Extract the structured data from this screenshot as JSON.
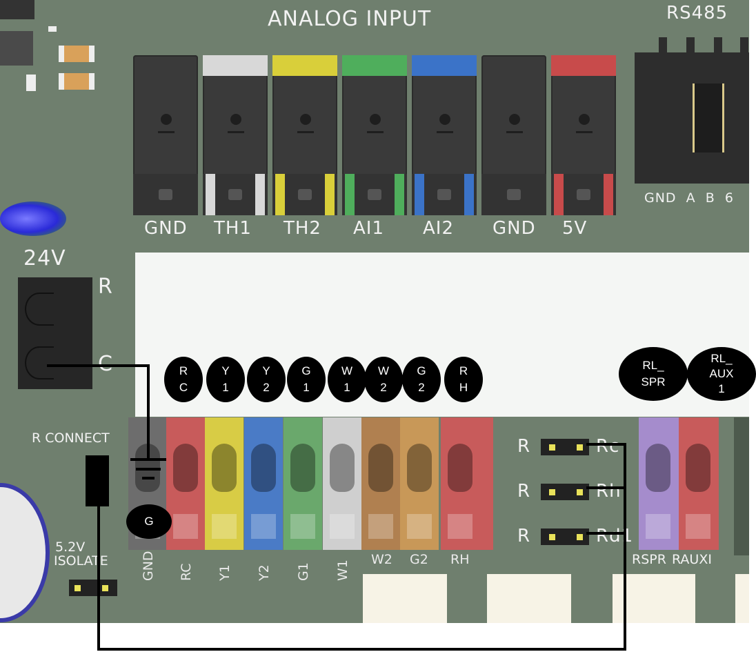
{
  "board": {
    "analog_header": "ANALOG INPUT",
    "rs485_header": "RS485",
    "analog_terminals": [
      {
        "label": "GND",
        "color": ""
      },
      {
        "label": "TH1",
        "color": "#d8d8d8"
      },
      {
        "label": "TH2",
        "color": "#d9cf3a"
      },
      {
        "label": "AI1",
        "color": "#4fae5c"
      },
      {
        "label": "AI2",
        "color": "#3b73c8"
      },
      {
        "label": "GND",
        "color": ""
      },
      {
        "label": "5V",
        "color": "#c84b4b"
      }
    ],
    "rs485_pins": "GND  A  B  6",
    "power_label": "24V",
    "power_r": "R",
    "power_c": "C",
    "r_connect": "R CONNECT",
    "isolate_line1": "5.2V",
    "isolate_line2": "ISOLATE",
    "bottom_terminals": [
      {
        "label": "GND",
        "color": "#6d6d6d"
      },
      {
        "label": "RC",
        "color": "#c85b5b"
      },
      {
        "label": "Y1",
        "color": "#d8cc45"
      },
      {
        "label": "Y2",
        "color": "#4a7bc6"
      },
      {
        "label": "G1",
        "color": "#6aa86c"
      },
      {
        "label": "W1",
        "color": "#cfcfcf"
      },
      {
        "label": "W2",
        "color": "#b08050"
      },
      {
        "label": "G2",
        "color": "#c89858"
      },
      {
        "label": "RH",
        "color": "#c85b5b"
      }
    ],
    "jumpers": [
      {
        "left": "R",
        "right": "Rc"
      },
      {
        "left": "R",
        "right": "Rh"
      },
      {
        "left": "R",
        "right": "Rd1"
      }
    ],
    "relay_terminals": [
      {
        "label": "RSPR",
        "color": "#a58ccc"
      },
      {
        "label": "RAUXI",
        "color": "#c85b5b"
      }
    ]
  },
  "bubbles": [
    {
      "id": "rc",
      "text": "R\nC"
    },
    {
      "id": "y1",
      "text": "Y\n1"
    },
    {
      "id": "y2",
      "text": "Y\n2"
    },
    {
      "id": "g1",
      "text": "G\n1"
    },
    {
      "id": "w1",
      "text": "W\n1"
    },
    {
      "id": "w2",
      "text": "W\n2"
    },
    {
      "id": "g2",
      "text": "G\n2"
    },
    {
      "id": "rh",
      "text": "R\nH"
    },
    {
      "id": "rl-spr",
      "text": "RL_\nSPR"
    },
    {
      "id": "rl-aux",
      "text": "RL_\nAUX\n1"
    },
    {
      "id": "ground",
      "text": "G"
    }
  ]
}
